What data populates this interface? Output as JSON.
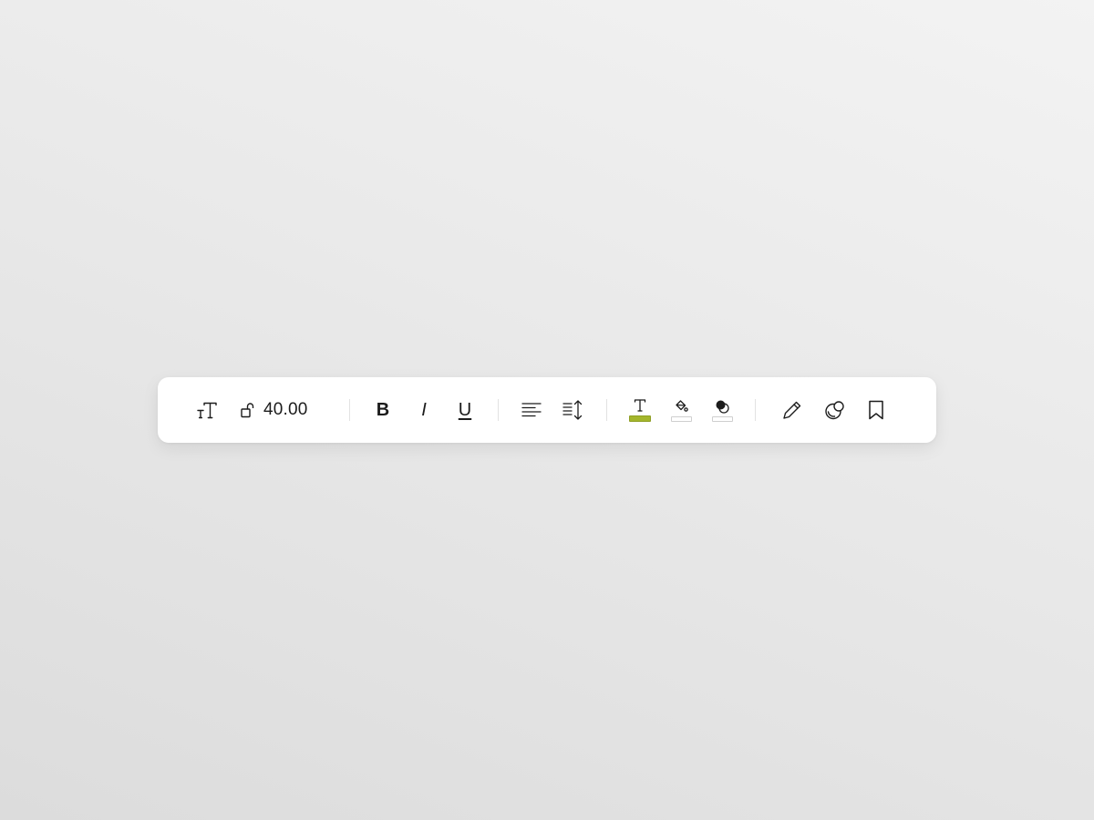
{
  "toolbar": {
    "text_size_icon": "text-size-icon",
    "lock_icon": "unlock-icon",
    "font_size_value": "40.00",
    "bold_label": "B",
    "italic_label": "I",
    "underline_label": "U",
    "align_icon": "align-left-icon",
    "line_height_icon": "line-height-icon",
    "text_color_icon": "text-color-icon",
    "fill_icon": "paint-bucket-icon",
    "shadow_icon": "shadow-icon",
    "pencil_icon": "pencil-icon",
    "effects_icon": "blend-icon",
    "bookmark_icon": "bookmark-icon",
    "text_color": "#a4b62c",
    "fill_color": "#ffffff",
    "shadow_color": "#ffffff"
  }
}
